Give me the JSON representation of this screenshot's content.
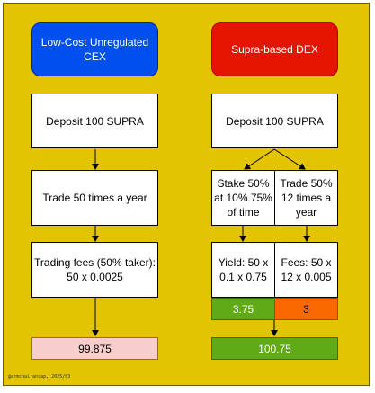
{
  "left": {
    "header": "Low-Cost Unregulated CEX",
    "deposit": "Deposit 100 SUPRA",
    "trade": "Trade 50 times a year",
    "fees": "Trading fees (50% taker): 50 x 0.0025",
    "result": "99.875"
  },
  "right": {
    "header": "Supra-based DEX",
    "deposit": "Deposit 100 SUPRA",
    "stake": "Stake 50% at 10% 75% of time",
    "trade": "Trade 50% 12 times a year",
    "yield": "Yield: 50 x 0.1 x 0.75",
    "fees": "Fees: 50 x 12 x 0.005",
    "yield_value": "3.75",
    "fees_value": "3",
    "result": "100.75"
  },
  "footer": "@armchairancap, 2025/03",
  "colors": {
    "background": "#e2c400",
    "cex_header": "#0050ef",
    "dex_header": "#e51400",
    "yield_value": "#60a917",
    "fees_value": "#fa6800",
    "cex_result": "#f8cecc",
    "dex_result": "#60a917"
  }
}
